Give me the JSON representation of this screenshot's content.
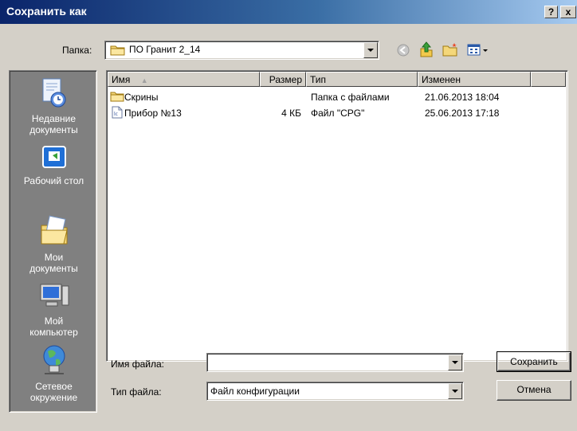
{
  "window": {
    "title": "Сохранить как",
    "help_label": "?",
    "close_label": "x"
  },
  "location": {
    "label": "Папка:",
    "value": "ПО Гранит 2_14"
  },
  "toolbar": {
    "icons": [
      "back-icon",
      "up-folder-icon",
      "new-folder-icon",
      "view-menu-icon"
    ]
  },
  "places": [
    {
      "label_1": "Недавние",
      "label_2": "документы",
      "icon": "recent-documents-icon"
    },
    {
      "label_1": "Рабочий стол",
      "label_2": "",
      "icon": "desktop-icon"
    },
    {
      "label_1": "Мои",
      "label_2": "документы",
      "icon": "my-documents-icon"
    },
    {
      "label_1": "Мой",
      "label_2": "компьютер",
      "icon": "my-computer-icon"
    },
    {
      "label_1": "Сетевое",
      "label_2": "окружение",
      "icon": "network-places-icon"
    }
  ],
  "file_list": {
    "columns": [
      "Имя",
      "Размер",
      "Тип",
      "Изменен"
    ],
    "sort_column": "Имя",
    "rows": [
      {
        "name": "Скрины",
        "size": "",
        "type": "Папка с файлами",
        "modified": "21.06.2013 18:04",
        "icon": "folder-icon"
      },
      {
        "name": "Прибор №13",
        "size": "4 КБ",
        "type": "Файл \"CPG\"",
        "modified": "25.06.2013 17:18",
        "icon": "cpg-file-icon"
      }
    ]
  },
  "filename": {
    "label": "Имя файла:",
    "value": ""
  },
  "filetype": {
    "label": "Тип файла:",
    "value": "Файл конфигурации"
  },
  "buttons": {
    "save_label": "Сохранить",
    "cancel_label": "Отмена"
  },
  "colors": {
    "title_start": "#0a246a",
    "title_end": "#a6caf0",
    "face": "#d4d0c8",
    "places_bg": "#808080"
  }
}
